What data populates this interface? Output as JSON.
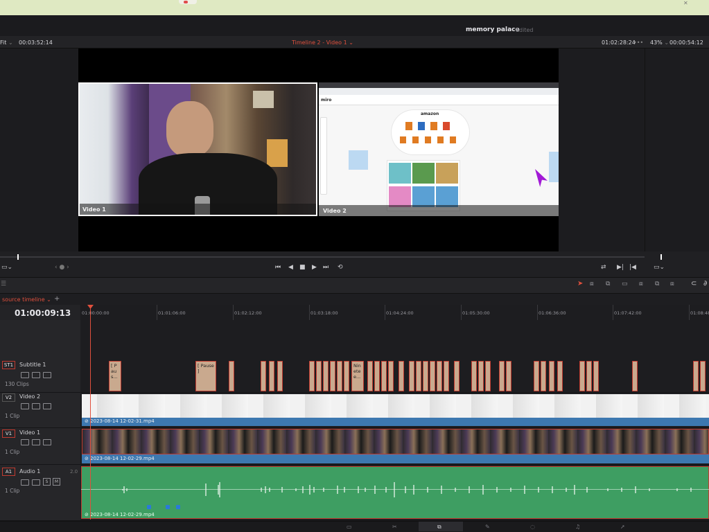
{
  "project": {
    "name": "memory palace",
    "status": "Edited"
  },
  "viewer_header": {
    "fit": "Fit",
    "source_tc": "00:03:52:14",
    "title": "Timeline 2 - Video 1",
    "record_tc": "01:02:28:24",
    "zoom": "43%",
    "right_tc": "00:00:54:12"
  },
  "viewer": {
    "video1_label": "Video 1",
    "video2_label": "Video 2"
  },
  "timeline": {
    "tab": "source timeline",
    "timecode": "01:00:09:13",
    "ruler": [
      "01:00:00:00",
      "01:01:06:00",
      "01:02:12:00",
      "01:03:18:00",
      "01:04:24:00",
      "01:05:30:00",
      "01:06:36:00",
      "01:07:42:00",
      "01:08:48:0"
    ]
  },
  "tracks": {
    "st1": {
      "badge": "ST1",
      "name": "Subtitle 1",
      "clips": "130 Clips",
      "sub_texts": [
        "[ P au s...",
        "[ Pause ]",
        "Nin ete e..."
      ]
    },
    "v2": {
      "badge": "V2",
      "name": "Video 2",
      "clips": "1 Clip",
      "clip_name": "2023-08-14 12-02-31.mp4"
    },
    "v1": {
      "badge": "V1",
      "name": "Video 1",
      "clips": "1 Clip",
      "clip_name": "2023-08-14 12-02-29.mp4"
    },
    "a1": {
      "badge": "A1",
      "name": "Audio 1",
      "channels": "2.0",
      "clips": "1 Clip",
      "clip_name": "2023-08-14 12-02-29.mp4",
      "s": "S",
      "m": "M"
    }
  },
  "colors": {
    "accent": "#e0503d",
    "subtitle_clip": "#c9a98e",
    "video_bar": "#3d78b0",
    "audio_clip": "#3e9e62"
  }
}
